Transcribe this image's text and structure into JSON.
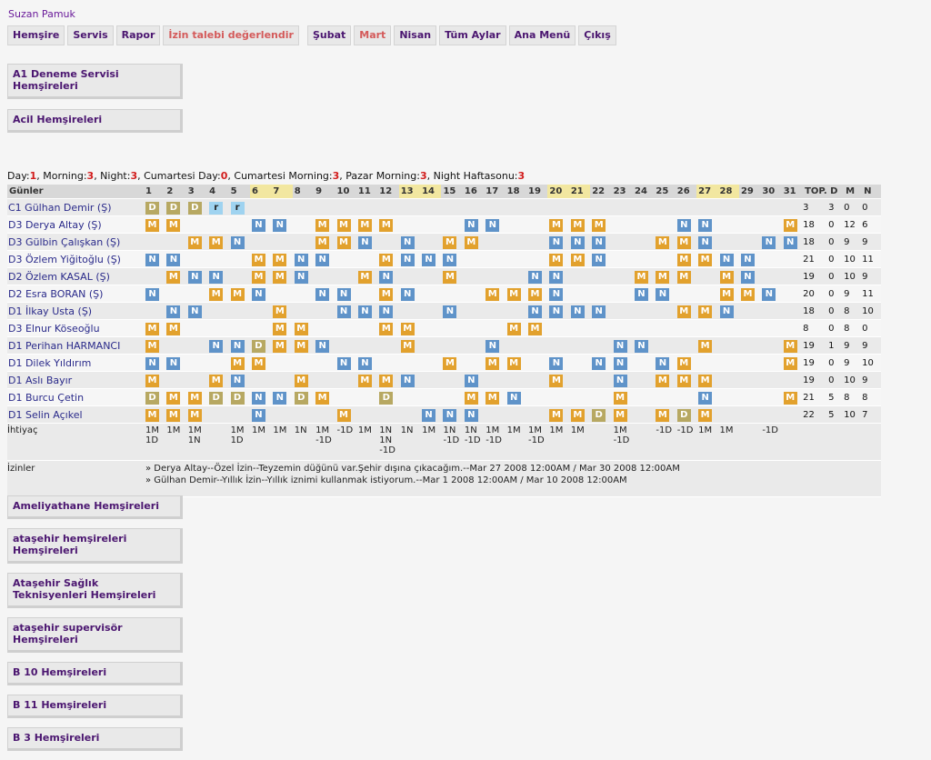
{
  "user": "Suzan Pamuk",
  "menu": [
    {
      "label": "Hemşire",
      "red": false
    },
    {
      "label": "Servis",
      "red": false
    },
    {
      "label": "Rapor",
      "red": false
    },
    {
      "label": "İzin talebi değerlendir",
      "red": true
    },
    {
      "label": "Şubat",
      "red": false
    },
    {
      "label": "Mart",
      "red": true
    },
    {
      "label": "Nisan",
      "red": false
    },
    {
      "label": "Tüm Aylar",
      "red": false
    },
    {
      "label": "Ana Menü",
      "red": false
    },
    {
      "label": "Çıkış",
      "red": false
    }
  ],
  "sections_top": [
    "A1 Deneme Servisi Hemşireleri",
    "Acil Hemşireleri"
  ],
  "summary": {
    "day_label": "Day:",
    "day": "1",
    "morning_label": ", Morning:",
    "morning": "3",
    "night_label": ", Night:",
    "night": "3",
    "cday_label": ", Cumartesi Day:",
    "cday": "0",
    "cmorning_label": ", Cumartesi Morning:",
    "cmorning": "3",
    "pmorning_label": ", Pazar Morning:",
    "pmorning": "3",
    "nweek_label": ", Night Haftasonu:",
    "nweek": "3"
  },
  "schedule": {
    "header_label": "Günler",
    "days": [
      "1",
      "2",
      "3",
      "4",
      "5",
      "6",
      "7",
      "8",
      "9",
      "10",
      "11",
      "12",
      "13",
      "14",
      "15",
      "16",
      "17",
      "18",
      "19",
      "20",
      "21",
      "22",
      "23",
      "24",
      "25",
      "26",
      "27",
      "28",
      "29",
      "30",
      "31"
    ],
    "weekend_days": [
      6,
      7,
      13,
      14,
      20,
      21,
      27,
      28
    ],
    "total_headers": [
      "TOP.",
      "D",
      "M",
      "N"
    ],
    "rows": [
      {
        "name": "C1 Gülhan Demir (Ş)",
        "cells": "DDDrr..........................",
        "totals": [
          "3",
          "3",
          "0",
          "0"
        ]
      },
      {
        "name": "D3 Derya Altay (Ş)",
        "cells": "MM...NN.MMMM...NN..MMM...NN...MM...",
        "totals": [
          "18",
          "0",
          "12",
          "6"
        ]
      },
      {
        "name": "D3 Gülbin Çalışkan (Ş)",
        "cells": "..MMN...MMN.N.MM...NNN..MMN..NN..M",
        "totals": [
          "18",
          "0",
          "9",
          "9"
        ]
      },
      {
        "name": "D3 Özlem Yiğitoğlu (Ş)",
        "cells": "NN...MMNN..MNNN....MMN...MMNN...MMN",
        "totals": [
          "21",
          "0",
          "10",
          "11"
        ]
      },
      {
        "name": "D2 Özlem KASAL (Ş)",
        "cells": ".MNN.MMN..MN..M...NN...MMM.MN..NM",
        "totals": [
          "19",
          "0",
          "10",
          "9"
        ]
      },
      {
        "name": "D2 Esra BORAN (Ş)",
        "cells": "N..MMN..NN.MN...MMMN...NN..MMN...NN",
        "totals": [
          "20",
          "0",
          "9",
          "11"
        ]
      },
      {
        "name": "D1 İlkay Usta (Ş)",
        "cells": ".NN...M..NNN..N...NNNN...MMN...MM..",
        "totals": [
          "18",
          "0",
          "8",
          "10"
        ]
      },
      {
        "name": "D3 Elnur Köseoğlu",
        "cells": "MM....MM...MM....MM...",
        "totals": [
          "8",
          "0",
          "8",
          "0"
        ]
      },
      {
        "name": "D1 Perihan HARMANCI",
        "cells": "M..NNDMMN...M...N.....NN..M...M..M",
        "totals": [
          "19",
          "1",
          "9",
          "9"
        ]
      },
      {
        "name": "D1 Dilek Yıldırım",
        "cells": "NN..MM...NN...M.MM.N.NN.NM....MM..N",
        "totals": [
          "19",
          "0",
          "9",
          "10"
        ]
      },
      {
        "name": "D1 Aslı Bayır",
        "cells": "M..MN..M..MMN..N...M..N.MMM....MM",
        "totals": [
          "19",
          "0",
          "10",
          "9"
        ]
      },
      {
        "name": "D1 Burcu Çetin",
        "cells": "DMMDDNNDM..D...MMN....M...N...M...N",
        "totals": [
          "21",
          "5",
          "8",
          "8"
        ]
      },
      {
        "name": "D1 Selin Açıkel",
        "cells": "MMM..N...M...NNN...MMDM.MDM....NN.DMD",
        "totals": [
          "22",
          "5",
          "10",
          "7"
        ]
      }
    ],
    "ihtiyac_label": "İhtiyaç",
    "ihtiyac": [
      "1M\n1D",
      "1M",
      "1M\n1N",
      "",
      "1M\n1D",
      "1M",
      "1M",
      "1N",
      "1M\n-1D",
      "-1D",
      "1M",
      "1N\n1N\n-1D",
      "1N",
      "1M",
      "1N\n-1D",
      "1N\n-1D",
      "1M\n-1D",
      "1M",
      "1M\n-1D",
      "1M",
      "1M",
      "",
      "1M\n-1D",
      "",
      "-1D",
      "-1D",
      "1M",
      "1M",
      "",
      "-1D",
      ""
    ],
    "izinler_label": "İzinler",
    "izinler": [
      "» Derya Altay--Özel İzin--Teyzemin düğünü var.Şehir dışına çıkacağım.--Mar 27 2008 12:00AM / Mar 30 2008 12:00AM",
      "» Gülhan Demir--Yıllık İzin--Yıllık iznimi kullanmak istiyorum.--Mar 1 2008 12:00AM / Mar 10 2008 12:00AM"
    ]
  },
  "sections_bottom": [
    "Ameliyathane Hemşireleri",
    "ataşehir hemşireleri Hemşireleri",
    "Ataşehir Sağlık Teknisyenleri Hemşireleri",
    "ataşehir supervisör Hemşireleri",
    "B 10 Hemşireleri",
    "B 11 Hemşireleri",
    "B 3 Hemşireleri"
  ],
  "colors": {
    "M": "#e2a12d",
    "N": "#5f93c9",
    "D": "#b7a862",
    "r": "#9fd3f0",
    "accent": "#4b1670",
    "value": "#d21e1e"
  }
}
